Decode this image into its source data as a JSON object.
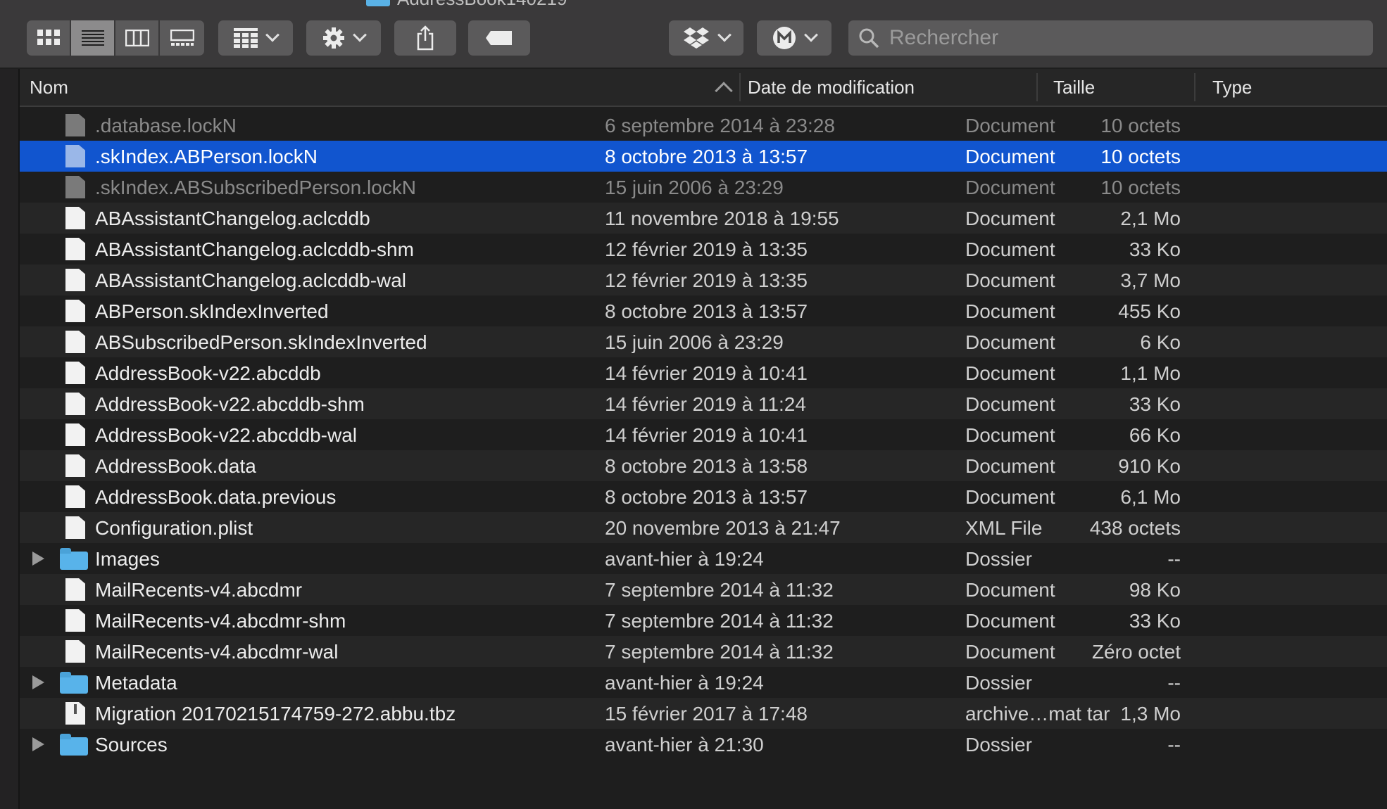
{
  "window": {
    "title": "AddressBook140219"
  },
  "toolbar": {
    "view_buttons": [
      "icon-view",
      "list-view",
      "column-view",
      "gallery-view"
    ],
    "active_view": 1,
    "search_placeholder": "Rechercher"
  },
  "columns": {
    "name": "Nom",
    "date": "Date de modification",
    "size": "Taille",
    "type": "Type"
  },
  "rows": [
    {
      "name": ".database.lockN",
      "date": "6 septembre 2014 à 23:28",
      "size": "10 octets",
      "type": "Document",
      "kind": "doc",
      "dim": true
    },
    {
      "name": ".skIndex.ABPerson.lockN",
      "date": "8 octobre 2013 à 13:57",
      "size": "10 octets",
      "type": "Document",
      "kind": "doc",
      "dim": true,
      "selected": true
    },
    {
      "name": ".skIndex.ABSubscribedPerson.lockN",
      "date": "15 juin 2006 à 23:29",
      "size": "10 octets",
      "type": "Document",
      "kind": "doc",
      "dim": true
    },
    {
      "name": "ABAssistantChangelog.aclcddb",
      "date": "11 novembre 2018 à 19:55",
      "size": "2,1 Mo",
      "type": "Document",
      "kind": "doc"
    },
    {
      "name": "ABAssistantChangelog.aclcddb-shm",
      "date": "12 février 2019 à 13:35",
      "size": "33 Ko",
      "type": "Document",
      "kind": "doc"
    },
    {
      "name": "ABAssistantChangelog.aclcddb-wal",
      "date": "12 février 2019 à 13:35",
      "size": "3,7 Mo",
      "type": "Document",
      "kind": "doc"
    },
    {
      "name": "ABPerson.skIndexInverted",
      "date": "8 octobre 2013 à 13:57",
      "size": "455 Ko",
      "type": "Document",
      "kind": "doc"
    },
    {
      "name": "ABSubscribedPerson.skIndexInverted",
      "date": "15 juin 2006 à 23:29",
      "size": "6 Ko",
      "type": "Document",
      "kind": "doc"
    },
    {
      "name": "AddressBook-v22.abcddb",
      "date": "14 février 2019 à 10:41",
      "size": "1,1 Mo",
      "type": "Document",
      "kind": "doc"
    },
    {
      "name": "AddressBook-v22.abcddb-shm",
      "date": "14 février 2019 à 11:24",
      "size": "33 Ko",
      "type": "Document",
      "kind": "doc"
    },
    {
      "name": "AddressBook-v22.abcddb-wal",
      "date": "14 février 2019 à 10:41",
      "size": "66 Ko",
      "type": "Document",
      "kind": "doc"
    },
    {
      "name": "AddressBook.data",
      "date": "8 octobre 2013 à 13:58",
      "size": "910 Ko",
      "type": "Document",
      "kind": "doc"
    },
    {
      "name": "AddressBook.data.previous",
      "date": "8 octobre 2013 à 13:57",
      "size": "6,1 Mo",
      "type": "Document",
      "kind": "doc"
    },
    {
      "name": "Configuration.plist",
      "date": "20 novembre 2013 à 21:47",
      "size": "438 octets",
      "type": "XML File",
      "kind": "doc"
    },
    {
      "name": "Images",
      "date": "avant-hier à 19:24",
      "size": "--",
      "type": "Dossier",
      "kind": "folder"
    },
    {
      "name": "MailRecents-v4.abcdmr",
      "date": "7 septembre 2014 à 11:32",
      "size": "98 Ko",
      "type": "Document",
      "kind": "doc"
    },
    {
      "name": "MailRecents-v4.abcdmr-shm",
      "date": "7 septembre 2014 à 11:32",
      "size": "33 Ko",
      "type": "Document",
      "kind": "doc"
    },
    {
      "name": "MailRecents-v4.abcdmr-wal",
      "date": "7 septembre 2014 à 11:32",
      "size": "Zéro octet",
      "type": "Document",
      "kind": "doc"
    },
    {
      "name": "Metadata",
      "date": "avant-hier à 19:24",
      "size": "--",
      "type": "Dossier",
      "kind": "folder"
    },
    {
      "name": "Migration 20170215174759-272.abbu.tbz",
      "date": "15 février 2017 à 17:48",
      "size": "1,3 Mo",
      "type": "archive…mat tar",
      "kind": "archive"
    },
    {
      "name": "Sources",
      "date": "avant-hier à 21:30",
      "size": "--",
      "type": "Dossier",
      "kind": "folder"
    }
  ],
  "colors": {
    "selection": "#1155cf",
    "folder": "#58b3ea",
    "background": "#1e1e1e"
  }
}
